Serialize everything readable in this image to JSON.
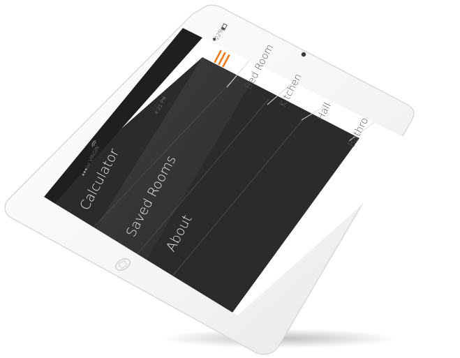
{
  "status_bar": {
    "carrier": "●●●○○ VIRGIN",
    "time": "4:21 PM",
    "battery": "22%",
    "icons": {
      "wifi": "wifi-icon",
      "bluetooth": "bluetooth-icon",
      "battery": "battery-icon"
    }
  },
  "menu": {
    "items": [
      {
        "label": "Calculator"
      },
      {
        "label": "Saved Rooms"
      },
      {
        "label": "About"
      }
    ],
    "hamburger_icon": "hamburger-menu-icon"
  },
  "rooms": {
    "tabs": [
      {
        "label": "Bed Room"
      },
      {
        "label": "Kitchen"
      },
      {
        "label": "Hall"
      },
      {
        "label": "Bathroom"
      }
    ]
  },
  "colors": {
    "accent": "#f07a1a",
    "panel_dark": "#2b2b2b",
    "device_body": "#f6f6f6"
  }
}
